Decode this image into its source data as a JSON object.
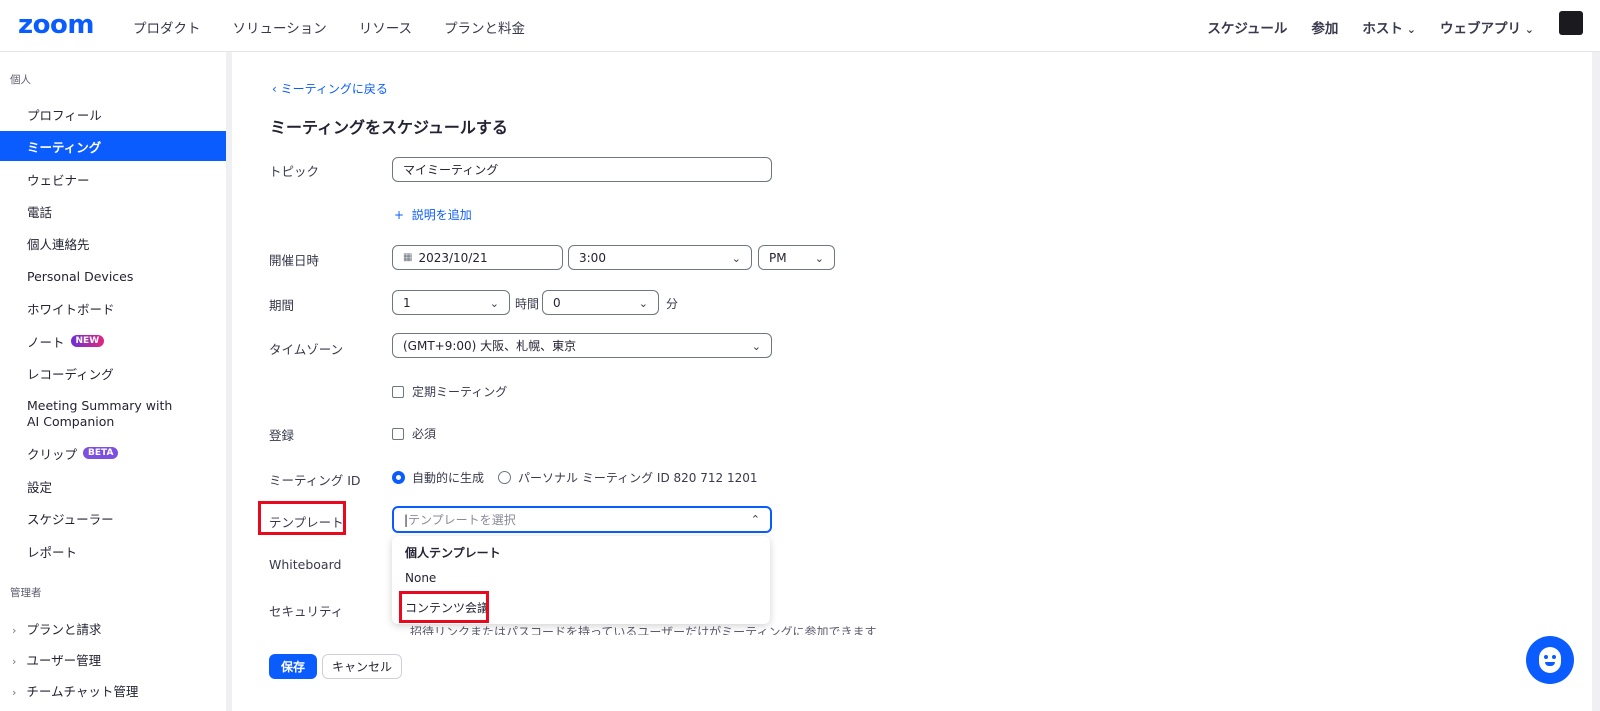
{
  "header": {
    "logo": "zoom",
    "nav": [
      "プロダクト",
      "ソリューション",
      "リソース",
      "プランと料金"
    ],
    "right": {
      "schedule": "スケジュール",
      "join": "参加",
      "host": "ホスト",
      "webapp": "ウェブアプリ"
    }
  },
  "sidebar": {
    "personal_label": "個人",
    "items": [
      {
        "label": "プロフィール"
      },
      {
        "label": "ミーティング",
        "active": true
      },
      {
        "label": "ウェビナー"
      },
      {
        "label": "電話"
      },
      {
        "label": "個人連絡先"
      },
      {
        "label": "Personal Devices"
      },
      {
        "label": "ホワイトボード"
      },
      {
        "label": "ノート",
        "badge": "NEW"
      },
      {
        "label": "レコーディング"
      },
      {
        "label": "Meeting Summary with AI Companion"
      },
      {
        "label": "クリップ",
        "badge": "BETA"
      },
      {
        "label": "設定"
      },
      {
        "label": "スケジューラー"
      },
      {
        "label": "レポート"
      }
    ],
    "admin_label": "管理者",
    "admin_items": [
      "プランと請求",
      "ユーザー管理",
      "チームチャット管理"
    ]
  },
  "form": {
    "back_link": "ミーティングに戻る",
    "title": "ミーティングをスケジュールする",
    "topic_label": "トピック",
    "topic_value": "マイミーティング",
    "add_description": "説明を追加",
    "datetime_label": "開催日時",
    "date_value": "2023/10/21",
    "time_value": "3:00",
    "ampm_value": "PM",
    "duration_label": "期間",
    "hours_value": "1",
    "hours_unit": "時間",
    "minutes_value": "0",
    "minutes_unit": "分",
    "timezone_label": "タイムゾーン",
    "timezone_value": "(GMT+9:00) 大阪、札幌、東京",
    "recurring": "定期ミーティング",
    "registration_label": "登録",
    "required": "必須",
    "meeting_id_label": "ミーティング ID",
    "auto_generate": "自動的に生成",
    "personal_id": "パーソナル ミーティング ID 820 712 1201",
    "template_label": "テンプレート",
    "template_placeholder": "テンプレートを選択",
    "whiteboard_label": "Whiteboard",
    "security_label": "セキュリティ",
    "security_note": "招待リンクまたはパスコードを持っているユーザーだけがミーティングに参加できます",
    "save": "保存",
    "cancel": "キャンセル"
  },
  "dropdown": {
    "group_header": "個人テンプレート",
    "options": [
      "None",
      "コンテンツ会議"
    ]
  },
  "colors": {
    "accent": "#0b5cff",
    "highlight": "#e8091e"
  }
}
